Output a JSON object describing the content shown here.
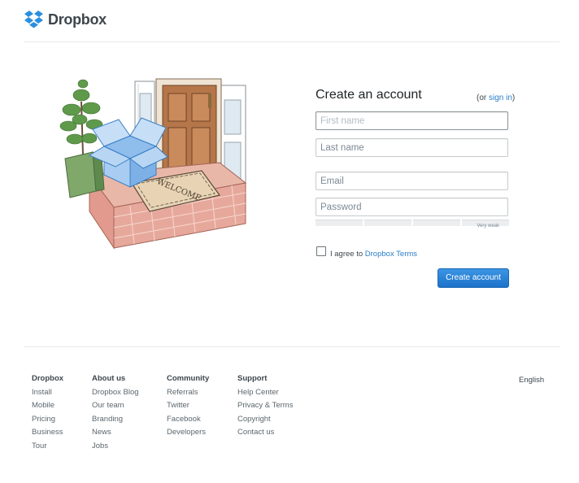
{
  "header": {
    "brand": "Dropbox"
  },
  "signup": {
    "title": "Create an account",
    "signin_prefix": "(or ",
    "signin_link": "sign in",
    "signin_suffix": ")",
    "first_name_placeholder": "First name",
    "last_name_placeholder": "Last name",
    "email_placeholder": "Email",
    "password_placeholder": "Password",
    "strength_label": "Very weak",
    "agree_prefix": "I agree to ",
    "agree_link": "Dropbox Terms",
    "submit_label": "Create account"
  },
  "illustration": {
    "mat_text": "WELCOME"
  },
  "footer": {
    "columns": [
      {
        "heading": "Dropbox",
        "items": [
          "Install",
          "Mobile",
          "Pricing",
          "Business",
          "Tour"
        ]
      },
      {
        "heading": "About us",
        "items": [
          "Dropbox Blog",
          "Our team",
          "Branding",
          "News",
          "Jobs"
        ]
      },
      {
        "heading": "Community",
        "items": [
          "Referrals",
          "Twitter",
          "Facebook",
          "Developers"
        ]
      },
      {
        "heading": "Support",
        "items": [
          "Help Center",
          "Privacy & Terms",
          "Copyright",
          "Contact us"
        ]
      }
    ],
    "language": "English"
  },
  "colors": {
    "brand_blue": "#2a7ec9",
    "button_blue": "#1d72c9",
    "text": "#3d464d"
  }
}
